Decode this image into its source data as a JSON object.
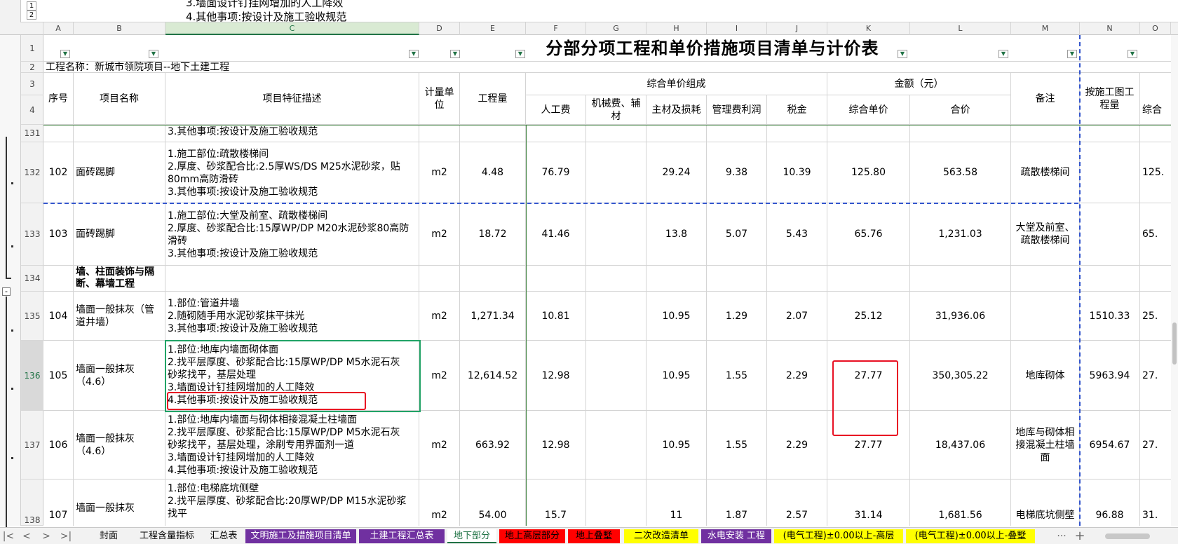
{
  "formula": {
    "level_buttons": [
      "1",
      "2"
    ],
    "lines": [
      "3.墙面设计钉挂网增加的人工降效",
      "4.其他事项:按设计及施工验收规范"
    ]
  },
  "outline_buttons": [
    "1",
    "2"
  ],
  "columns": [
    {
      "label": "A"
    },
    {
      "label": "B"
    },
    {
      "label": "C"
    },
    {
      "label": "D"
    },
    {
      "label": "E"
    },
    {
      "label": "F"
    },
    {
      "label": "G"
    },
    {
      "label": "H"
    },
    {
      "label": "I"
    },
    {
      "label": "J"
    },
    {
      "label": "K"
    },
    {
      "label": "L"
    },
    {
      "label": "M"
    },
    {
      "label": "N"
    },
    {
      "label": "O"
    }
  ],
  "sheet": {
    "title": "分部分项工程和单价措施项目清单与计价表",
    "project_name": "工程名称：新城市领院项目--地下土建工程",
    "headers": {
      "seq": "序号",
      "name": "项目名称",
      "desc": "项目特征描述",
      "unit": "计量单位",
      "qty": "工程量",
      "unit_price_group": "综合单价组成",
      "labor": "人工费",
      "machine": "机械费、辅材",
      "material": "主材及损耗",
      "mgmt": "管理费利润",
      "tax": "税金",
      "amount_group": "金额（元）",
      "comp_price": "综合单价",
      "total": "合价",
      "note": "备注",
      "drawing_qty": "按施工图工程量",
      "comp_short": "综合"
    },
    "row_numbers": [
      "1",
      "2",
      "3",
      "4",
      "131",
      "132",
      "133",
      "134",
      "135",
      "136",
      "137",
      "138"
    ],
    "rows": [
      {
        "rn": "131",
        "seq": "",
        "name": "",
        "desc": [
          "3.其他事项:按设计及施工验收规范"
        ],
        "unit": "",
        "qty": "",
        "labor": "",
        "machine": "",
        "material": "",
        "mgmt": "",
        "tax": "",
        "comp_price": "",
        "total": "",
        "note": "",
        "drawing_qty": "",
        "extra": ""
      },
      {
        "rn": "132",
        "seq": "102",
        "name": "面砖踢脚",
        "desc": [
          "1.施工部位:疏散楼梯间",
          "2.厚度、砂浆配合比:2.5厚WS/DS M25水泥砂浆，贴",
          "80mm高防滑砖",
          "3.其他事项:按设计及施工验收规范"
        ],
        "unit": "m2",
        "qty": "4.48",
        "labor": "76.79",
        "machine": "",
        "material": "29.24",
        "mgmt": "9.38",
        "tax": "10.39",
        "comp_price": "125.80",
        "total": "563.58",
        "note": "疏散楼梯间",
        "drawing_qty": "",
        "extra": "125."
      },
      {
        "rn": "133",
        "seq": "103",
        "name": "面砖踢脚",
        "desc": [
          "1.施工部位:大堂及前室、疏散楼梯间",
          "2.厚度、砂浆配合比:15厚WP/DP M20水泥砂浆80高防",
          "滑砖",
          "3.其他事项:按设计及施工验收规范"
        ],
        "unit": "m2",
        "qty": "18.72",
        "labor": "41.46",
        "machine": "",
        "material": "13.8",
        "mgmt": "5.07",
        "tax": "5.43",
        "comp_price": "65.76",
        "total": "1,231.03",
        "note": "大堂及前室、疏散楼梯间",
        "drawing_qty": "",
        "extra": "65."
      },
      {
        "rn": "134",
        "seq": "",
        "name": "墙、柱面装饰与隔断、幕墙工程",
        "desc": [],
        "unit": "",
        "qty": "",
        "labor": "",
        "machine": "",
        "material": "",
        "mgmt": "",
        "tax": "",
        "comp_price": "",
        "total": "",
        "note": "",
        "drawing_qty": "",
        "extra": ""
      },
      {
        "rn": "135",
        "seq": "104",
        "name": "墙面一般抹灰（管道井墙）",
        "desc": [
          "1.部位:管道井墙",
          "2.随砌随手用水泥砂浆抹平抹光",
          "3.其他事项:按设计及施工验收规范"
        ],
        "unit": "m2",
        "qty": "1,271.34",
        "labor": "10.81",
        "machine": "",
        "material": "10.95",
        "mgmt": "1.29",
        "tax": "2.07",
        "comp_price": "25.12",
        "total": "31,936.06",
        "note": "",
        "drawing_qty": "1510.33",
        "extra": "25."
      },
      {
        "rn": "136",
        "seq": "105",
        "name": "墙面一般抹灰（4.6）",
        "desc": [
          "1.部位:地库内墙面砌体面",
          "2.找平层厚度、砂浆配合比:15厚WP/DP M5水泥石灰",
          "砂浆找平，基层处理",
          "3.墙面设计钉挂网增加的人工降效",
          "4.其他事项:按设计及施工验收规范"
        ],
        "unit": "m2",
        "qty": "12,614.52",
        "labor": "12.98",
        "machine": "",
        "material": "10.95",
        "mgmt": "1.55",
        "tax": "2.29",
        "comp_price": "27.77",
        "total": "350,305.22",
        "note": "地库砌体",
        "drawing_qty": "5963.94",
        "extra": "27."
      },
      {
        "rn": "137",
        "seq": "106",
        "name": "墙面一般抹灰（4.6）",
        "desc": [
          "1.部位:地库内墙面与砌体相接混凝土柱墙面",
          "2.找平层厚度、砂浆配合比:15厚WP/DP M5水泥石灰",
          "砂浆找平，基层处理，涂刷专用界面剂一道",
          "3.墙面设计钉挂网增加的人工降效",
          "4.其他事项:按设计及施工验收规范"
        ],
        "unit": "m2",
        "qty": "663.92",
        "labor": "12.98",
        "machine": "",
        "material": "10.95",
        "mgmt": "1.55",
        "tax": "2.29",
        "comp_price": "27.77",
        "total": "18,437.06",
        "note": "地库与砌体相接混凝土柱墙面",
        "drawing_qty": "6954.67",
        "extra": "27."
      },
      {
        "rn": "138",
        "seq": "107",
        "name": "墙面一般抹灰",
        "desc": [
          "1.部位:电梯底坑侧壁",
          "2.找平层厚度、砂浆配合比:20厚WP/DP M15水泥砂浆",
          "找平"
        ],
        "unit": "m2",
        "qty": "54.00",
        "labor": "15.7",
        "machine": "",
        "material": "11",
        "mgmt": "1.87",
        "tax": "2.57",
        "comp_price": "31.14",
        "total": "1,681.56",
        "note": "电梯底坑侧壁",
        "drawing_qty": "96.88",
        "extra": "31."
      }
    ]
  },
  "tabs": {
    "nav": [
      "|<",
      "<",
      ">",
      ">|"
    ],
    "items": [
      {
        "label": "封面",
        "color": ""
      },
      {
        "label": "工程含量指标",
        "color": ""
      },
      {
        "label": "汇总表",
        "color": ""
      },
      {
        "label": "文明施工及措施项目清单",
        "color": "#7030a0"
      },
      {
        "label": "土建工程汇总表",
        "color": "#7030a0"
      },
      {
        "label": "地下部分",
        "color": "",
        "active": true
      },
      {
        "label": "地上高层部分",
        "color": "#ff0000"
      },
      {
        "label": "地上叠墅",
        "color": "#ff0000"
      },
      {
        "label": "二次改造清单",
        "color": "#ffff00"
      },
      {
        "label": "水电安装 工程",
        "color": "#7030a0"
      },
      {
        "label": "(电气工程)±0.00以上-高层",
        "color": "#ffff00"
      },
      {
        "label": "(电气工程)±0.00以上-叠墅",
        "color": "#ffff00"
      }
    ],
    "more": "···",
    "add": "+"
  },
  "colors": {
    "accent": "#217346",
    "selection": "#21a366",
    "highlight_box": "#e81123",
    "page_break": "#3355cc"
  }
}
